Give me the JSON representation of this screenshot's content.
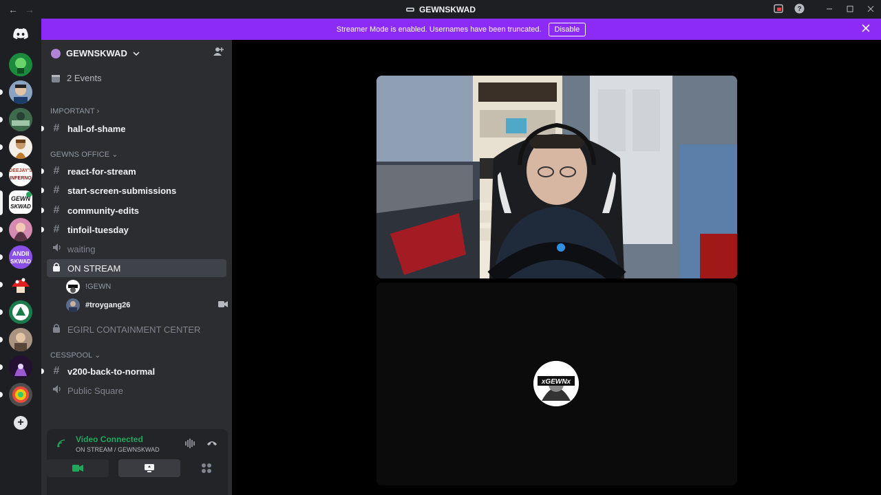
{
  "window": {
    "title": "GEWNSKWAD",
    "back_icon": "←",
    "forward_icon": "→"
  },
  "banner": {
    "message": "Streamer Mode is enabled. Usernames have been truncated.",
    "button": "Disable"
  },
  "server": {
    "name": "GEWNSKWAD",
    "events": "2 Events"
  },
  "categories": {
    "important": "IMPORTANT",
    "gewns_office": "GEWNS OFFICE",
    "cesspool": "CESSPOOL"
  },
  "channels": {
    "hall_of_shame": "hall-of-shame",
    "react_for_stream": "react-for-stream",
    "start_screen": "start-screen-submissions",
    "community_edits": "community-edits",
    "tinfoil_tuesday": "tinfoil-tuesday",
    "waiting": "waiting",
    "on_stream": "ON STREAM",
    "egirl": "EGIRL CONTAINMENT CENTER",
    "v200": "v200-back-to-normal",
    "public_square": "Public Square"
  },
  "voice_users": [
    {
      "name": "!GEWN"
    },
    {
      "name": "#troygang26"
    }
  ],
  "voice_panel": {
    "status": "Video Connected",
    "location": "ON STREAM / GEWNSKWAD"
  },
  "stage": {
    "avatar_text": "xGEWNx"
  },
  "colors": {
    "banner": "#8c2bf5",
    "connected": "#23a55a",
    "sidebar": "#2b2d31",
    "rail": "#1e1f22"
  }
}
